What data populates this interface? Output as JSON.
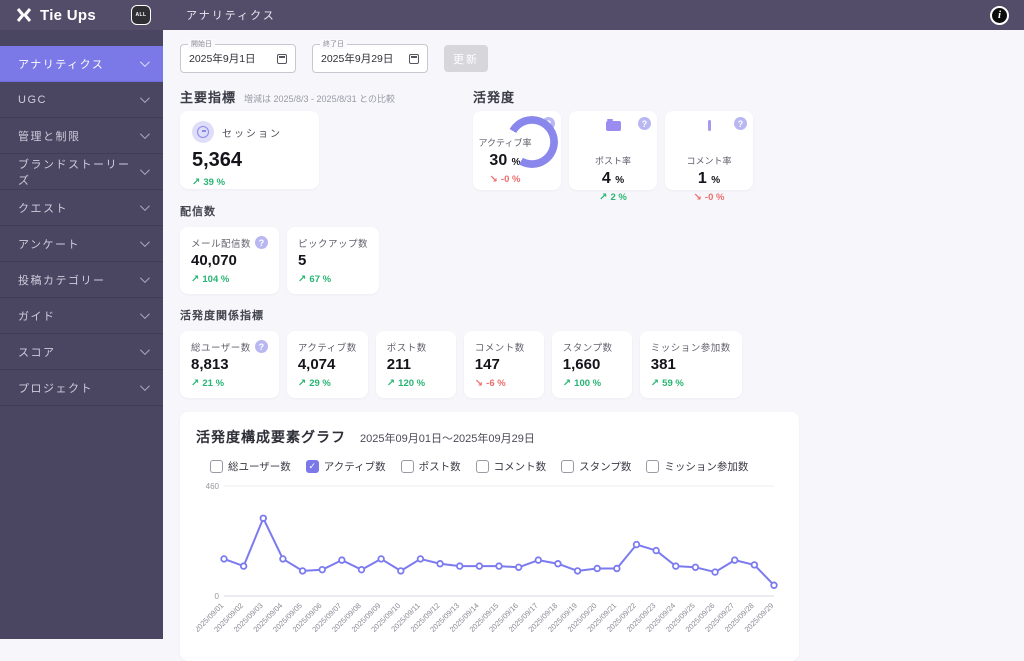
{
  "colors": {
    "accent": "#7b79e8",
    "up_green": "#27b572",
    "down_red": "#ee6d6d",
    "sidebar_bg": "#4a4561",
    "header_bg": "#534d69"
  },
  "header": {
    "brand": "Tie Ups",
    "avatar_label": "ALL",
    "page_title": "アナリティクス"
  },
  "sidebar": {
    "items": [
      {
        "label": "アナリティクス",
        "state": "active"
      },
      {
        "label": "UGC"
      },
      {
        "label": "管理と制限"
      },
      {
        "label": "ブランドストーリーズ"
      },
      {
        "label": "クエスト"
      },
      {
        "label": "アンケート"
      },
      {
        "label": "投稿カテゴリー"
      },
      {
        "label": "ガイド"
      },
      {
        "label": "スコア"
      },
      {
        "label": "プロジェクト"
      }
    ]
  },
  "filters": {
    "start_label": "開始日",
    "start_value": "2025年9月1日",
    "end_label": "終了日",
    "end_value": "2025年9月29日",
    "update_label": "更新"
  },
  "sections": {
    "main_indicators": {
      "title": "主要指標",
      "note": "増減は 2025/8/3 - 2025/8/31 との比較",
      "cards": [
        {
          "label": "セッション",
          "value": "5,364",
          "change": "39 %",
          "trend": "up"
        }
      ]
    },
    "activity": {
      "title": "活発度",
      "cards": [
        {
          "label": "アクティブ率",
          "value": "30",
          "unit": "%",
          "change": "-0 %",
          "trend": "down",
          "icon": "gauge",
          "card_class": "with-gauge",
          "help": true
        },
        {
          "label": "ポスト率",
          "value": "4",
          "unit": "%",
          "change": "2 %",
          "trend": "up",
          "icon": "folder",
          "help": true
        },
        {
          "label": "コメント率",
          "value": "1",
          "unit": "%",
          "change": "-0 %",
          "trend": "down",
          "icon": "bar",
          "help": true
        }
      ]
    },
    "delivery": {
      "title": "配信数",
      "cards": [
        {
          "label": "メール配信数",
          "value": "40,070",
          "change": "104 %",
          "trend": "up",
          "help": true
        },
        {
          "label": "ピックアップ数",
          "value": "5",
          "change": "67 %",
          "trend": "up"
        }
      ]
    },
    "activity_metrics": {
      "title": "活発度関係指標",
      "cards": [
        {
          "label": "総ユーザー数",
          "value": "8,813",
          "change": "21 %",
          "trend": "up",
          "help": true
        },
        {
          "label": "アクティブ数",
          "value": "4,074",
          "change": "29 %",
          "trend": "up"
        },
        {
          "label": "ポスト数",
          "value": "211",
          "change": "120 %",
          "trend": "up"
        },
        {
          "label": "コメント数",
          "value": "147",
          "change": "-6 %",
          "trend": "down"
        },
        {
          "label": "スタンプ数",
          "value": "1,660",
          "change": "100 %",
          "trend": "up"
        },
        {
          "label": "ミッション参加数",
          "value": "381",
          "change": "59 %",
          "trend": "up"
        }
      ]
    }
  },
  "chart": {
    "title": "活発度構成要素グラフ",
    "subtitle": "2025年09月01日〜2025年09月29日",
    "legend": [
      {
        "label": "総ユーザー数"
      },
      {
        "label": "アクティブ数",
        "state": "checked"
      },
      {
        "label": "ポスト数"
      },
      {
        "label": "コメント数"
      },
      {
        "label": "スタンプ数"
      },
      {
        "label": "ミッション参加数"
      }
    ]
  },
  "chart_data": {
    "type": "line",
    "x": [
      "2025/09/01",
      "2025/09/02",
      "2025/09/03",
      "2025/09/04",
      "2025/09/05",
      "2025/09/06",
      "2025/09/07",
      "2025/09/08",
      "2025/09/09",
      "2025/09/10",
      "2025/09/11",
      "2025/09/12",
      "2025/09/13",
      "2025/09/14",
      "2025/09/15",
      "2025/09/16",
      "2025/09/17",
      "2025/09/18",
      "2025/09/19",
      "2025/09/20",
      "2025/09/21",
      "2025/09/22",
      "2025/09/23",
      "2025/09/24",
      "2025/09/25",
      "2025/09/26",
      "2025/09/27",
      "2025/09/28",
      "2025/09/29"
    ],
    "series": [
      {
        "name": "アクティブ数",
        "values": [
          155,
          125,
          325,
          155,
          105,
          110,
          150,
          110,
          155,
          105,
          155,
          135,
          125,
          125,
          125,
          120,
          150,
          135,
          105,
          115,
          115,
          215,
          190,
          125,
          120,
          100,
          150,
          130,
          45
        ]
      }
    ],
    "ylim": [
      0,
      460
    ],
    "yticks": [
      0,
      460
    ],
    "line_color": "#7b7af0",
    "grid": true,
    "legend_position": "top"
  }
}
